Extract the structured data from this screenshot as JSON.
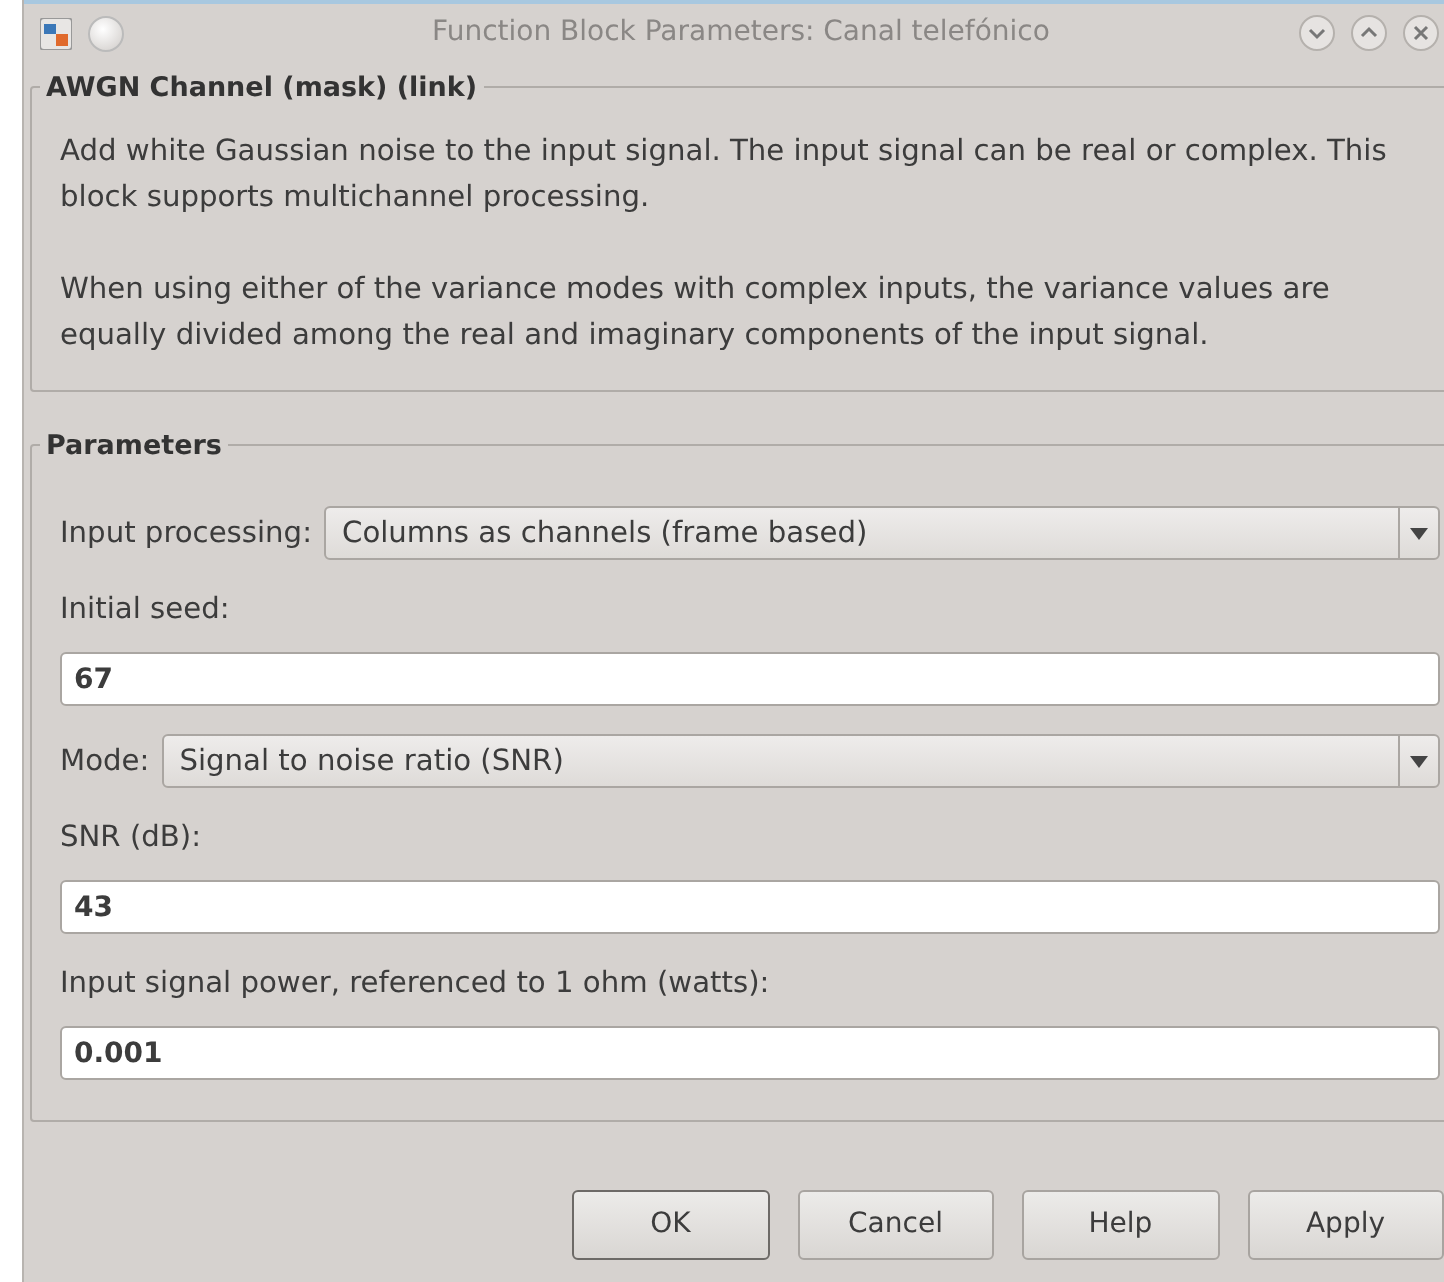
{
  "window": {
    "title": "Function Block Parameters: Canal telefónico"
  },
  "description": {
    "title": "AWGN Channel (mask) (link)",
    "paragraphs": [
      "Add white Gaussian noise to the input signal. The input signal can be real or complex. This block supports multichannel processing.",
      "When using either of the variance modes with complex inputs, the variance values are equally divided among the real and imaginary components of the input signal."
    ]
  },
  "parameters": {
    "title": "Parameters",
    "fields": [
      {
        "kind": "dropdown",
        "label": "Input processing:",
        "value": "Columns as channels (frame based)"
      },
      {
        "kind": "text",
        "label": "Initial seed:",
        "value": "67"
      },
      {
        "kind": "dropdown",
        "label": "Mode:",
        "value": "Signal to noise ratio  (SNR)"
      },
      {
        "kind": "text",
        "label": "SNR (dB):",
        "value": "43"
      },
      {
        "kind": "text",
        "label": "Input signal power, referenced to 1 ohm (watts):",
        "value": "0.001"
      }
    ]
  },
  "buttons": [
    {
      "label": "OK",
      "default": true
    },
    {
      "label": "Cancel",
      "default": false
    },
    {
      "label": "Help",
      "default": false
    },
    {
      "label": "Apply",
      "default": false
    }
  ]
}
